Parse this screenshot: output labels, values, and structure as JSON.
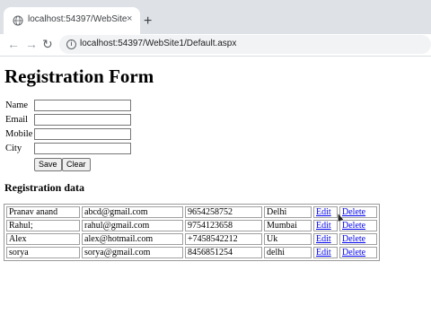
{
  "browser": {
    "tab_title": "localhost:54397/WebSite1/Defa...",
    "tab_close": "×",
    "new_tab": "+",
    "back": "←",
    "forward": "→",
    "reload": "↻",
    "info": "i",
    "url": "localhost:54397/WebSite1/Default.aspx"
  },
  "page": {
    "title": "Registration Form",
    "form": {
      "fields": [
        {
          "label": "Name",
          "value": ""
        },
        {
          "label": "Email",
          "value": ""
        },
        {
          "label": "Mobile",
          "value": ""
        },
        {
          "label": "City",
          "value": ""
        }
      ],
      "save_label": "Save",
      "clear_label": "Clear"
    },
    "data_heading": "Registration data",
    "rows": [
      {
        "name": "Pranav anand",
        "email": "abcd@gmail.com",
        "mobile": "9654258752",
        "city": "Delhi",
        "edit": "Edit",
        "delete": "Delete"
      },
      {
        "name": "Rahul;",
        "email": "rahul@gmail.com",
        "mobile": "9754123658",
        "city": "Mumbai",
        "edit": "Edit",
        "delete": "Delete"
      },
      {
        "name": "Alex",
        "email": "alex@hotmail.com",
        "mobile": "+7458542212",
        "city": "Uk",
        "edit": "Edit",
        "delete": "Delete"
      },
      {
        "name": "sorya",
        "email": "sorya@gmail.com",
        "mobile": "8456851254",
        "city": "delhi",
        "edit": "Edit",
        "delete": "Delete"
      }
    ]
  }
}
